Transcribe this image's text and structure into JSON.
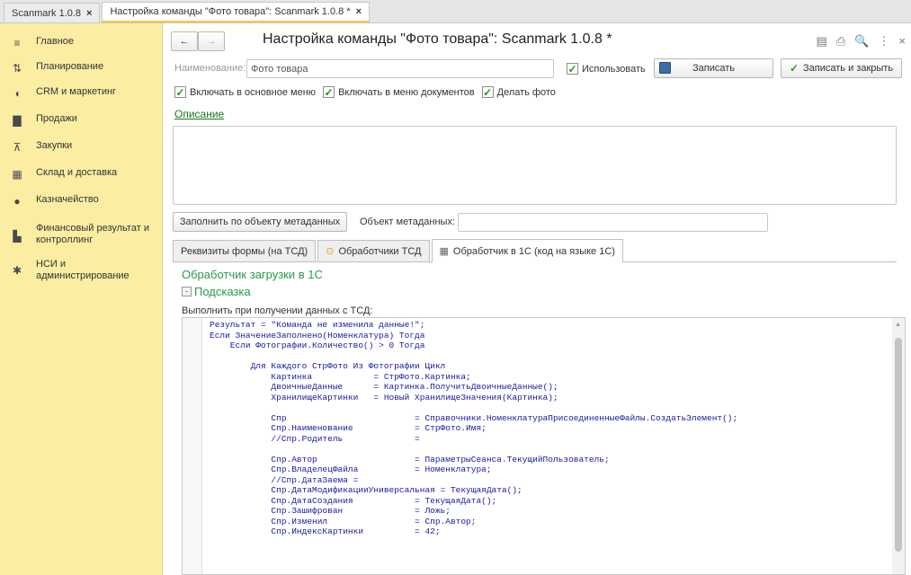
{
  "tabs_top": [
    {
      "label": "Scanmark 1.0.8",
      "close": "×"
    },
    {
      "label": "Настройка команды \"Фото товара\": Scanmark 1.0.8 *",
      "close": "×"
    }
  ],
  "sidebar": {
    "items": [
      {
        "label": "Главное",
        "icon": "menu-icon"
      },
      {
        "label": "Планирование",
        "icon": "planning-icon"
      },
      {
        "label": "CRM и маркетинг",
        "icon": "crm-icon"
      },
      {
        "label": "Продажи",
        "icon": "bag-icon"
      },
      {
        "label": "Закупки",
        "icon": "cart-icon"
      },
      {
        "label": "Склад и доставка",
        "icon": "warehouse-icon"
      },
      {
        "label": "Казначейство",
        "icon": "treasury-icon"
      },
      {
        "label": "Финансовый результат и контроллинг",
        "icon": "chart-icon"
      },
      {
        "label": "НСИ и администрирование",
        "icon": "gear-icon"
      }
    ]
  },
  "header": {
    "title": "Настройка команды \"Фото товара\": Scanmark 1.0.8 *",
    "back": "←",
    "forward": "→",
    "icons": [
      "▤",
      "⎙",
      "🔍",
      "⋮",
      "×"
    ]
  },
  "form": {
    "name_label": "Наименование:",
    "name_value": "Фото товара",
    "use_label": "Использовать",
    "use_checked": "✓",
    "save_label": "Записать",
    "save_close_label": "Записать и закрыть",
    "include_main_menu": "Включать в основное меню",
    "include_doc_menu": "Включать в меню документов",
    "make_photo": "Делать фото",
    "check": "✓",
    "description_link": "Описание",
    "fill_button": "Заполнить по объекту метаданных",
    "metadata_label": "Объект метаданных:",
    "metadata_value": ""
  },
  "tabs": [
    {
      "label": "Реквизиты формы (на ТСД)"
    },
    {
      "label": "Обработчики ТСД",
      "icon": "⊙"
    },
    {
      "label": "Обработчик в 1С  (код на языке 1С)",
      "icon": "▦"
    }
  ],
  "handler": {
    "title": "Обработчик загрузки в 1С",
    "hint": "Подсказка",
    "hint_box": "-",
    "exec_label": "Выполнить при получении данных с ТСД:",
    "code": "Результат = \"Команда не изменила данные!\";\nЕсли ЗначениеЗаполнено(Номенклатура) Тогда\n    Если Фотографии.Количество() > 0 Тогда\n\n        Для Каждого СтрФото Из Фотографии Цикл\n            Картинка            = СтрФото.Картинка;\n            ДвоичныеДанные      = Картинка.ПолучитьДвоичныеДанные();\n            ХранилищеКартинки   = Новый ХранилищеЗначения(Картинка);\n\n            Спр                         = Справочники.НоменклатураПрисоединенныеФайлы.СоздатьЭлемент();\n            Спр.Наименование            = СтрФото.Имя;\n            //Спр.Родитель              =\n\n            Спр.Автор                   = ПараметрыСеанса.ТекущийПользователь;\n            Спр.ВладелецФайла           = Номенклатура;\n            //Спр.ДатаЗаема =\n            Спр.ДатаМодификацииУниверсальная = ТекущаяДата();\n            Спр.ДатаСоздания            = ТекущаяДата();\n            Спр.Зашифрован              = Ложь;\n            Спр.Изменил                 = Спр.Автор;\n            Спр.ИндексКартинки          = 42;"
  }
}
